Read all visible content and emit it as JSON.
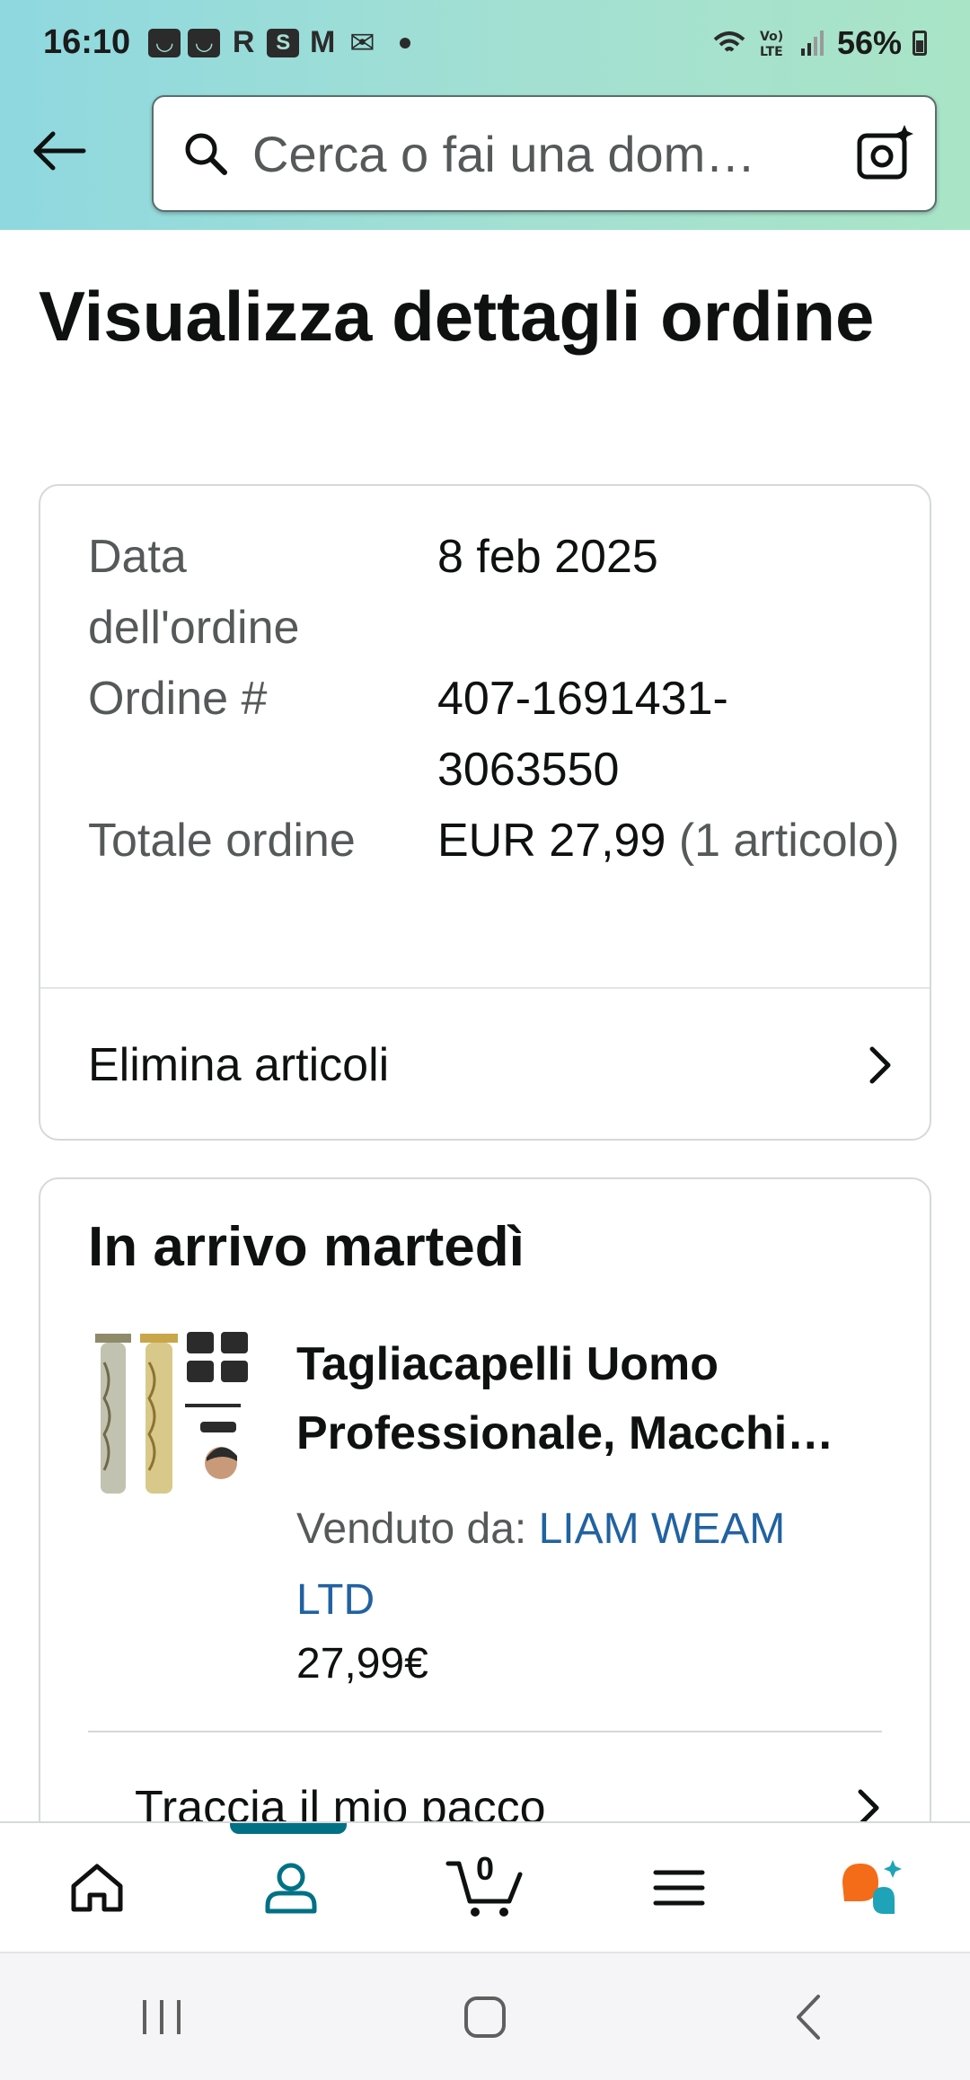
{
  "status_bar": {
    "time": "16:10",
    "notification_icons": [
      "app-icon",
      "app-icon",
      "r-icon",
      "s-icon",
      "gmail-icon",
      "mail-icon"
    ],
    "battery": "56%"
  },
  "header": {
    "search_placeholder": "Cerca o fai una domanda",
    "search_placeholder_visible": "Cerca o fai una dom…"
  },
  "page": {
    "title": "Visualizza dettagli ordine"
  },
  "order_summary": {
    "date_label": "Data dell'ordine",
    "date_value": "8 feb 2025",
    "order_label": "Ordine #",
    "order_value": "407-1691431-3063550",
    "total_label": "Totale ordine",
    "total_value": "EUR 27,99",
    "total_items": "(1 articolo)",
    "action": "Elimina articoli"
  },
  "delivery": {
    "title": "In arrivo martedì",
    "product_title": "Tagliacapelli Uomo Professionale, Macchi…",
    "seller_label": "Venduto da:",
    "seller_name": "LIAM WEAM LTD",
    "price": "27,99€",
    "track_label": "Traccia il mio pacco"
  },
  "bottom_nav": {
    "items": [
      "home-icon",
      "account-icon",
      "cart-icon",
      "menu-icon",
      "rufus-icon"
    ],
    "active": "account-icon",
    "cart_count": "0",
    "accent_color": "#007185"
  },
  "colors": {
    "header_gradient_start": "#8fd8e0",
    "header_gradient_end": "#a9e4c6",
    "link": "#2162a1",
    "rufus_orange": "#f46c17",
    "rufus_teal": "#1fa3b8"
  }
}
